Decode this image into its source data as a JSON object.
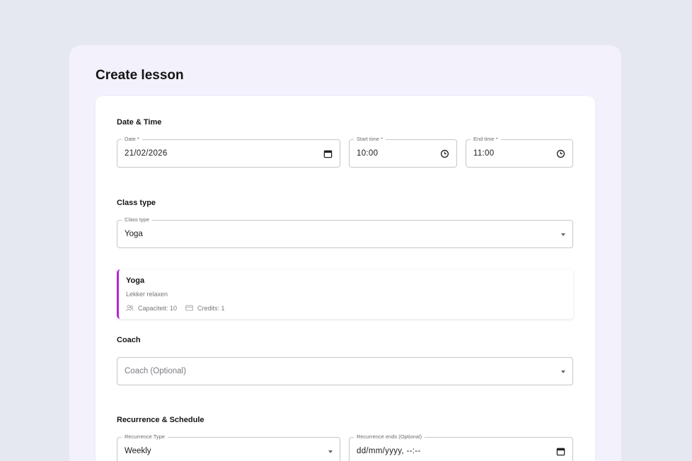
{
  "page": {
    "title": "Create lesson"
  },
  "sections": {
    "datetime": "Date & Time",
    "classtype": "Class type",
    "coach": "Coach",
    "recurrence": "Recurrence & Schedule"
  },
  "fields": {
    "date": {
      "label": "Date *",
      "value": "21/02/2026",
      "icon": "calendar-icon"
    },
    "start_time": {
      "label": "Start time *",
      "value": "10:00",
      "icon": "clock-icon"
    },
    "end_time": {
      "label": "End time *",
      "value": "11:00",
      "icon": "clock-icon"
    },
    "class_type": {
      "label": "Class type",
      "value": "Yoga"
    },
    "coach": {
      "placeholder": "Coach (Optional)"
    },
    "recurrence_type": {
      "label": "Recurrence Type",
      "value": "Weekly"
    },
    "recurrence_ends": {
      "label": "Recurrence ends (Optional)",
      "value": "dd/mm/yyyy, --:--",
      "icon": "calendar-icon"
    }
  },
  "class_info": {
    "title": "Yoga",
    "description": "Lekker relaxen",
    "capacity": "Capaciteit: 10",
    "credits": "Credits: 1"
  },
  "colors": {
    "accent": "#b328d0",
    "background": "#e6e8f1",
    "panel": "#f3f1fc"
  }
}
